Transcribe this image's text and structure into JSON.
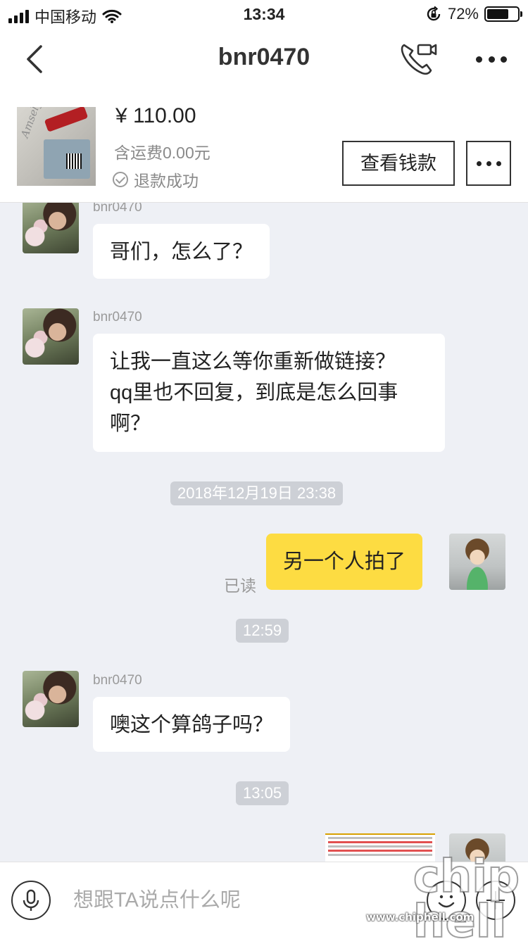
{
  "status_bar": {
    "carrier": "中国移动",
    "time": "13:34",
    "battery_percent": "72%",
    "battery_level": 0.72,
    "icons": [
      "signal-icon",
      "wifi-icon",
      "rotation-lock-icon",
      "battery-icon"
    ]
  },
  "nav": {
    "title": "bnr0470",
    "icons": [
      "back-icon",
      "video-call-icon",
      "more-icon"
    ]
  },
  "order": {
    "price": "¥ 110.00",
    "shipping": "含运费0.00元",
    "refund_status": "退款成功",
    "view_money_label": "查看钱款",
    "image_signature": "Amsely"
  },
  "messages": [
    {
      "type": "incoming",
      "sender": "bnr0470",
      "text": "哥们，怎么了？"
    },
    {
      "type": "incoming",
      "sender": "bnr0470",
      "lines": [
        "让我一直这么等你重新做链接？",
        "qq里也不回复，到底是怎么回事",
        "啊？"
      ]
    },
    {
      "type": "time",
      "text": "2018年12月19日  23:38"
    },
    {
      "type": "outgoing",
      "text": "另一个人拍了",
      "read_label": "已读"
    },
    {
      "type": "time",
      "text": "12:59"
    },
    {
      "type": "incoming",
      "sender": "bnr0470",
      "text": "噢这个算鸽子吗？"
    },
    {
      "type": "time",
      "text": "13:05"
    },
    {
      "type": "outgoing-image",
      "description": "screenshot"
    }
  ],
  "input_bar": {
    "placeholder": "想跟TA说点什么呢",
    "icons": [
      "microphone-icon",
      "emoji-icon",
      "plus-icon"
    ]
  },
  "watermark": {
    "logo": "chip hell",
    "url": "www.chiphell.com"
  },
  "colors": {
    "accent_yellow": "#fddc42",
    "chat_background": "#eef0f5",
    "time_chip": "#cdd0d6"
  }
}
